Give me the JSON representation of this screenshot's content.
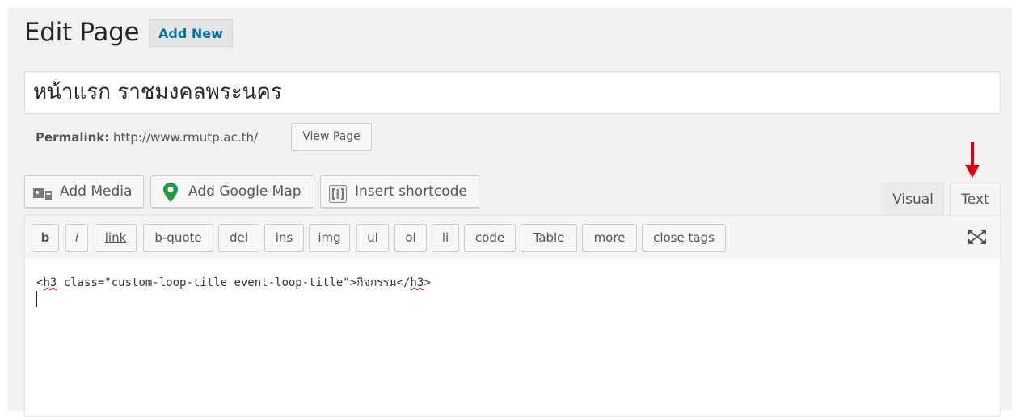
{
  "header": {
    "title": "Edit Page",
    "add_new_label": "Add New"
  },
  "post": {
    "title": "หน้าแรก ราชมงคลพระนคร",
    "permalink_label": "Permalink:",
    "permalink_url": "http://www.rmutp.ac.th/",
    "view_page_label": "View Page"
  },
  "media_buttons": [
    {
      "label": "Add Media",
      "icon": "media-icon"
    },
    {
      "label": "Add Google Map",
      "icon": "map-pin-icon"
    },
    {
      "label": "Insert shortcode",
      "icon": "shortcode-icon"
    }
  ],
  "editor_tabs": [
    {
      "label": "Visual"
    },
    {
      "label": "Text",
      "active": true
    }
  ],
  "quicktags": [
    "b",
    "i",
    "link",
    "b-quote",
    "del",
    "ins",
    "img",
    "ul",
    "ol",
    "li",
    "code",
    "Table",
    "more",
    "close tags"
  ],
  "editor": {
    "content_line1_open": "<",
    "content_line1_tag1": "h3",
    "content_line1_mid": " class=\"custom-loop-title event-loop-title\">กิจกรรม</",
    "content_line1_tag2": "h3",
    "content_line1_close": ">"
  },
  "colors": {
    "accent": "#0073aa",
    "annotation_arrow": "#e0000d",
    "map_pin": "#1e9e3e"
  }
}
